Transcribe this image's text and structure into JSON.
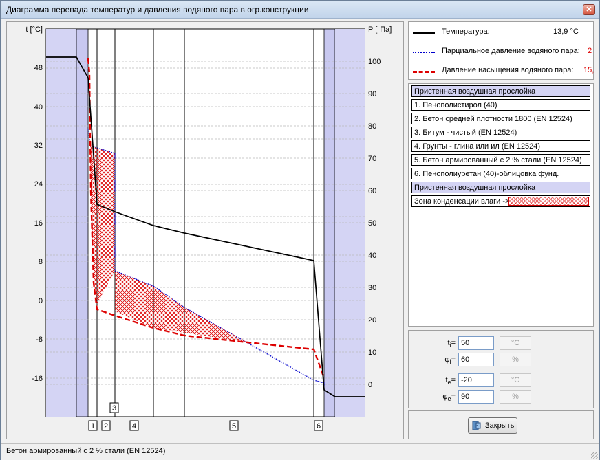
{
  "window": {
    "title": "Диаграмма перепада температур и давления водяного пара в огр.конструкции",
    "close": "✕"
  },
  "axes": {
    "left_label": "t [°C]",
    "right_label": "P [гПа]"
  },
  "legend": {
    "temperature": {
      "label": "Температура:",
      "value": "13,9 °C",
      "color": "#000000"
    },
    "partial": {
      "label": "Парциальное давление водяного пара:",
      "value": "2",
      "color": "#0000cc"
    },
    "saturation": {
      "label": "Давление насыщения водяного пара:",
      "value": "15,",
      "color": "#dd0000"
    }
  },
  "layers": [
    "Пристенная воздушная прослойка",
    "1. Пенополистирол (40)",
    "2. Бетон средней плотности 1800 (EN 12524)",
    "3. Битум - чистый (EN 12524)",
    "4. Грунты - глина или ил (EN 12524)",
    "5. Бетон армированный с 2 % стали (EN 12524)",
    "6. Пенополиуретан (40)-облицовка фунд.",
    "Пристенная воздушная прослойка",
    "Зона конденсации влаги ->"
  ],
  "params": {
    "ti": {
      "label": "t",
      "sub": "i",
      "value": "50",
      "unit": "°C"
    },
    "phii": {
      "label": "φ",
      "sub": "i",
      "value": "60",
      "unit": "%"
    },
    "te": {
      "label": "t",
      "sub": "e",
      "value": "-20",
      "unit": "°C"
    },
    "phie": {
      "label": "φ",
      "sub": "e",
      "value": "90",
      "unit": "%"
    }
  },
  "close_button": "Закрыть",
  "status": "Бетон армированный с 2 % стали (EN 12524)",
  "chart_data": {
    "type": "line",
    "left_axis": {
      "label": "t [°C]",
      "ticks": [
        48,
        40,
        32,
        24,
        16,
        8,
        0,
        -8,
        -16
      ]
    },
    "right_axis": {
      "label": "P [гПа]",
      "ticks": [
        100,
        90,
        80,
        70,
        60,
        50,
        40,
        30,
        20,
        10,
        0
      ]
    },
    "layer_markers": [
      "1",
      "2",
      "3",
      "4",
      "5",
      "6"
    ],
    "series": [
      {
        "name": "Температура",
        "axis": "left",
        "color": "#000000"
      },
      {
        "name": "Парциальное давление водяного пара",
        "axis": "right",
        "color": "#0000cc"
      },
      {
        "name": "Давление насыщения водяного пара",
        "axis": "right",
        "color": "#dd0000"
      }
    ],
    "colors": {
      "air_layer": "#d4d4f4",
      "condensation": "#dd0000"
    }
  }
}
